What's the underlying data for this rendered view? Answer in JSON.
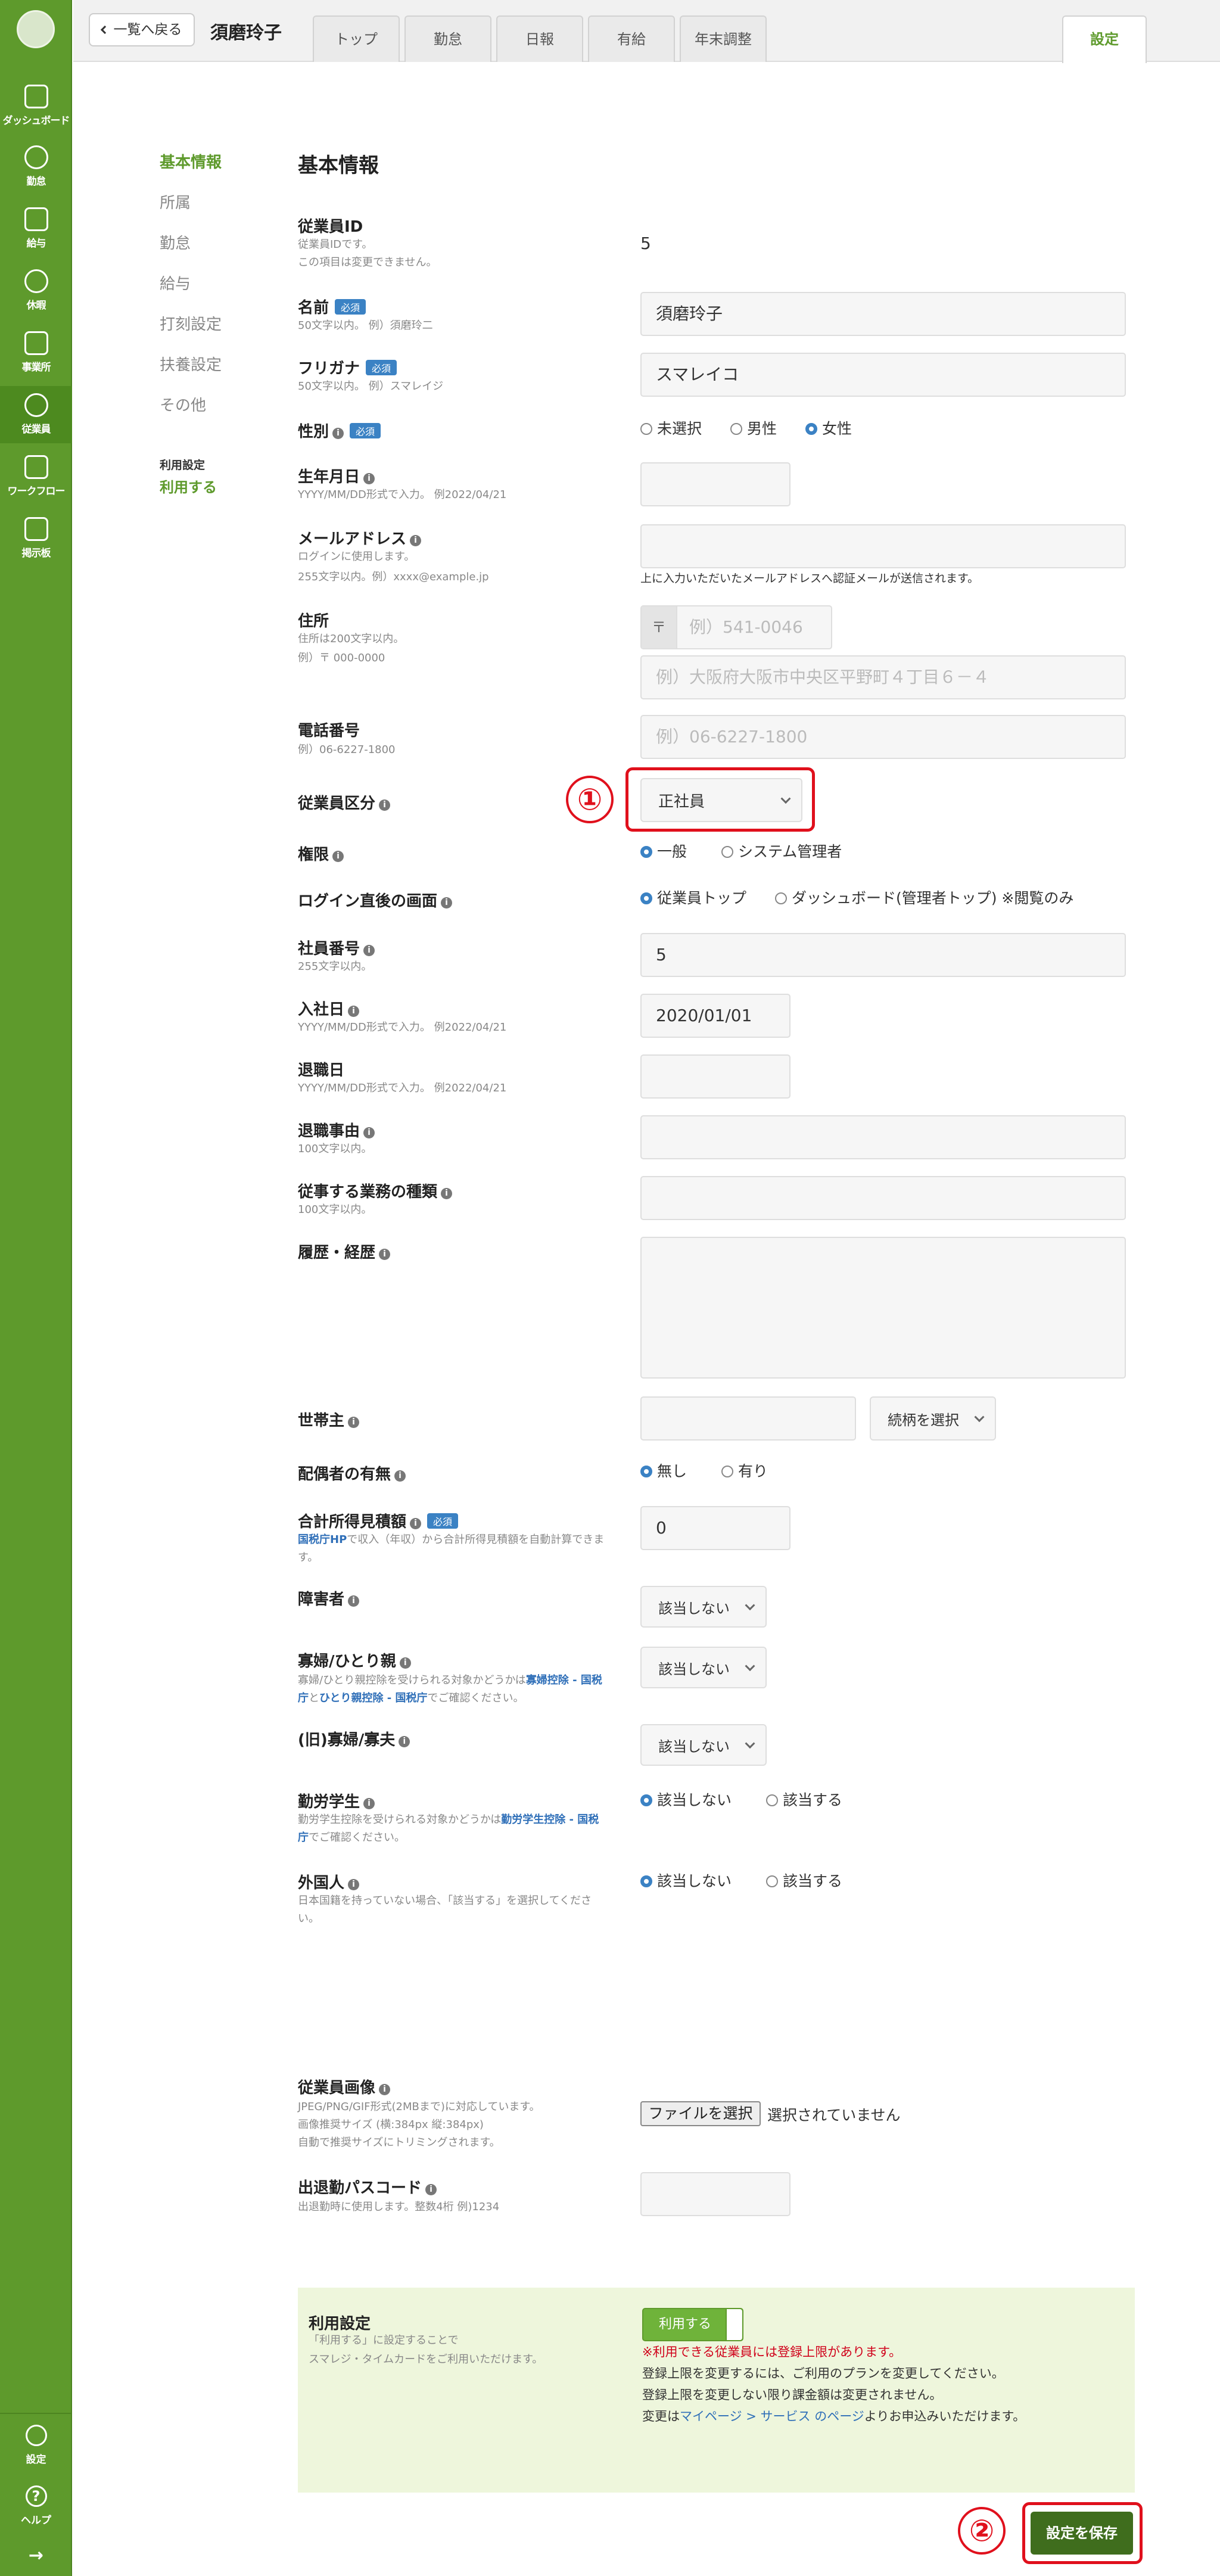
{
  "sidebar": {
    "items": [
      {
        "label": "ダッシュボード",
        "icon": "dashboard-icon"
      },
      {
        "label": "勤怠",
        "icon": "clock-icon"
      },
      {
        "label": "給与",
        "icon": "calculator-icon"
      },
      {
        "label": "休暇",
        "icon": "umbrella-icon"
      },
      {
        "label": "事業所",
        "icon": "home-icon"
      },
      {
        "label": "従業員",
        "icon": "person-icon"
      },
      {
        "label": "ワークフロー",
        "icon": "document-check-icon"
      },
      {
        "label": "掲示板",
        "icon": "chat-icon"
      }
    ],
    "settings_label": "設定",
    "help_label": "ヘルプ",
    "help_glyph": "?",
    "collapse_glyph": "→"
  },
  "header": {
    "back_label": "一覧へ戻る",
    "employee_name": "須磨玲子",
    "tabs": [
      "トップ",
      "勤怠",
      "日報",
      "有給",
      "年末調整"
    ],
    "active_tab": "設定"
  },
  "side_menu": {
    "items": [
      "基本情報",
      "所属",
      "勤怠",
      "給与",
      "打刻設定",
      "扶養設定",
      "その他"
    ],
    "usage_label": "利用設定",
    "usage_value": "利用する"
  },
  "form": {
    "title": "基本情報",
    "required_badge": "必須",
    "employee_id": {
      "label": "従業員ID",
      "sub1": "従業員IDです。",
      "sub2": "この項目は変更できません。",
      "value": "5"
    },
    "name": {
      "label": "名前",
      "sub": "50文字以内。 例）須磨玲二",
      "value": "須磨玲子"
    },
    "kana": {
      "label": "フリガナ",
      "sub": "50文字以内。 例）スマレイジ",
      "value": "スマレイコ"
    },
    "gender": {
      "label": "性別",
      "options": [
        "未選択",
        "男性",
        "女性"
      ],
      "selected": "女性"
    },
    "birthday": {
      "label": "生年月日",
      "sub": "YYYY/MM/DD形式で入力。 例2022/04/21",
      "value": ""
    },
    "email": {
      "label": "メールアドレス",
      "sub1": "ログインに使用します。",
      "sub2": "255文字以内。例）xxxx@example.jp",
      "value": "",
      "note": "上に入力いただいたメールアドレスへ認証メールが送信されます。"
    },
    "address": {
      "label": "住所",
      "sub1": "住所は200文字以内。",
      "sub2": "例）〒 000-0000",
      "postal_mark": "〒",
      "postal_placeholder": "例）541-0046",
      "address_placeholder": "例）大阪府大阪市中央区平野町４丁目６－４"
    },
    "phone": {
      "label": "電話番号",
      "sub": "例）06-6227-1800",
      "placeholder": "例）06-6227-1800"
    },
    "employment_type": {
      "label": "従業員区分",
      "value": "正社員"
    },
    "permission": {
      "label": "権限",
      "options": [
        "一般",
        "システム管理者"
      ],
      "selected": "一般"
    },
    "login_screen": {
      "label": "ログイン直後の画面",
      "options": [
        "従業員トップ",
        "ダッシュボード(管理者トップ) ※閲覧のみ"
      ],
      "selected": "従業員トップ"
    },
    "employee_number": {
      "label": "社員番号",
      "sub": "255文字以内。",
      "value": "5"
    },
    "hire_date": {
      "label": "入社日",
      "sub": "YYYY/MM/DD形式で入力。 例2022/04/21",
      "value": "2020/01/01"
    },
    "leave_date": {
      "label": "退職日",
      "sub": "YYYY/MM/DD形式で入力。 例2022/04/21",
      "value": ""
    },
    "leave_reason": {
      "label": "退職事由",
      "sub": "100文字以内。",
      "value": ""
    },
    "job_type": {
      "label": "従事する業務の種類",
      "sub": "100文字以内。",
      "value": ""
    },
    "history": {
      "label": "履歴・経歴",
      "value": ""
    },
    "householder": {
      "label": "世帯主",
      "value": "",
      "relation_placeholder": "続柄を選択"
    },
    "spouse": {
      "label": "配偶者の有無",
      "options": [
        "無し",
        "有り"
      ],
      "selected": "無し"
    },
    "income": {
      "label": "合計所得見積額",
      "sub_link": "国税庁HP",
      "sub_a": "で収入（年収）から合計所得見積額を自動計算できま",
      "sub_b": "す。",
      "value": "0"
    },
    "disability": {
      "label": "障害者",
      "value": "該当しない"
    },
    "widow": {
      "label": "寡婦/ひとり親",
      "sub_a": "寡婦/ひとり親控除を受けられる対象かどうかは",
      "link1": "寡婦控除 - 国税",
      "link1b": "庁",
      "and": "と",
      "link2": "ひとり親控除 - 国税庁",
      "sub_end": "でご確認ください。",
      "value": "該当しない"
    },
    "old_widow": {
      "label": "(旧)寡婦/寡夫",
      "value": "該当しない"
    },
    "student": {
      "label": "勤労学生",
      "sub_a": "勤労学生控除を受けられる対象かどうかは",
      "link": "勤労学生控除 - 国税",
      "link_b": "庁",
      "sub_end": "でご確認ください。",
      "options": [
        "該当しない",
        "該当する"
      ],
      "selected": "該当しない"
    },
    "foreigner": {
      "label": "外国人",
      "sub1": "日本国籍を持っていない場合、「該当する」を選択してくださ",
      "sub2": "い。",
      "options": [
        "該当しない",
        "該当する"
      ],
      "selected": "該当しない"
    },
    "photo": {
      "label": "従業員画像",
      "sub1": "JPEG/PNG/GIF形式(2MBまで)に対応しています。",
      "sub2": "画像推奨サイズ (横:384px 縦:384px)",
      "sub3": "自動で推奨サイズにトリミングされます。",
      "button": "ファイルを選択",
      "status": "選択されていません"
    },
    "passcode": {
      "label": "出退勤パスコード",
      "sub": "出退勤時に使用します。整数4桁 例)1234",
      "value": ""
    }
  },
  "usage_settings": {
    "title": "利用設定",
    "desc1": "「利用する」に設定することで",
    "desc2": "スマレジ・タイムカードをご利用いただけます。",
    "toggle_label": "利用する",
    "warning": "※利用できる従業員には登録上限があります。",
    "line1": "登録上限を変更するには、ご利用のプランを変更してください。",
    "line2": "登録上限を変更しない限り課金額は変更されません。",
    "line3_a": "変更は",
    "line3_link": "マイページ > サービス のページ",
    "line3_b": "よりお申込みいただけます。"
  },
  "save_label": "設定を保存",
  "annotations": {
    "marker1": "①",
    "marker2": "②",
    "color": "#e0101c"
  }
}
